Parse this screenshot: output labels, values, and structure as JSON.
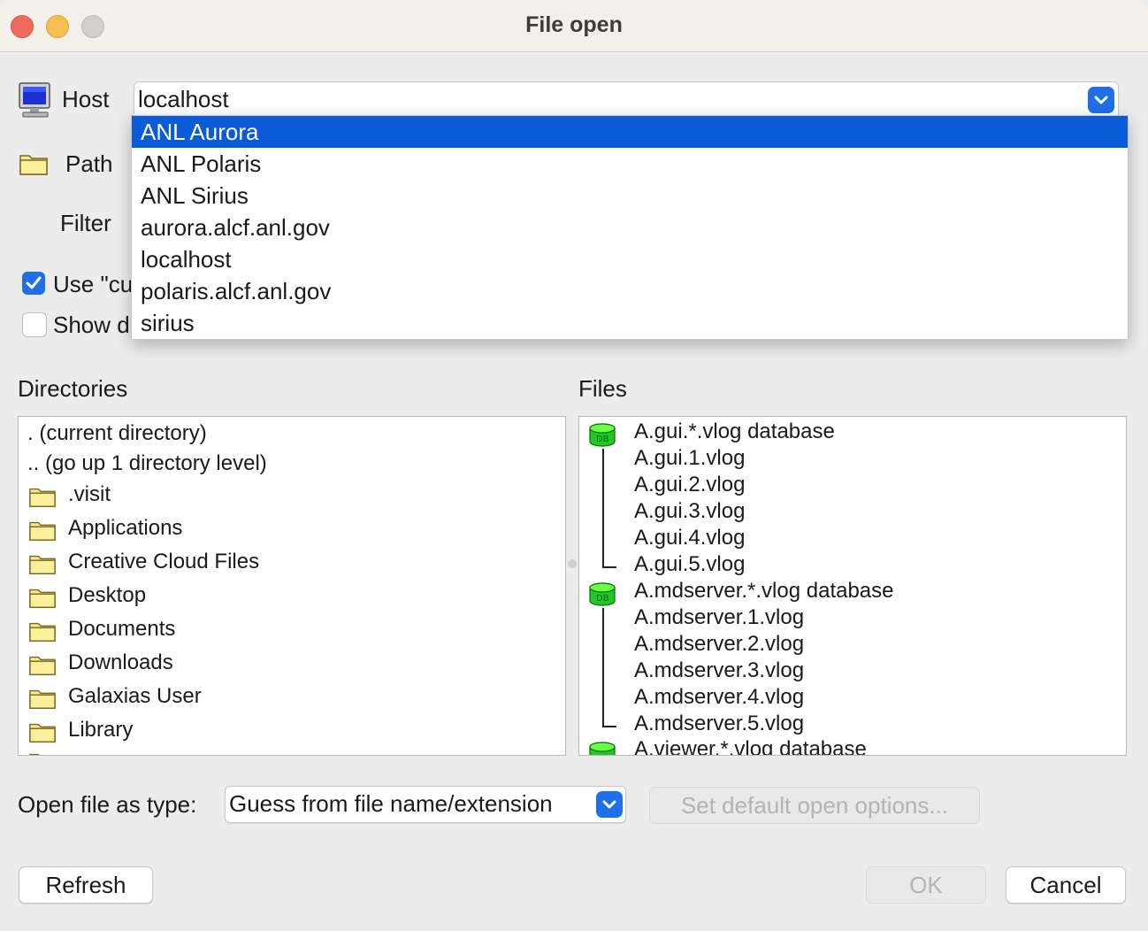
{
  "window": {
    "title": "File open"
  },
  "host": {
    "label": "Host",
    "value": "localhost"
  },
  "path": {
    "label": "Path"
  },
  "filter": {
    "label": "Filter"
  },
  "options": {
    "use_current_label": "Use \"cu",
    "use_current_checked": true,
    "show_label": "Show d",
    "show_checked": false
  },
  "host_dropdown": {
    "items": [
      "ANL Aurora",
      "ANL Polaris",
      "ANL Sirius",
      "aurora.alcf.anl.gov",
      "localhost",
      "polaris.alcf.anl.gov",
      "sirius"
    ],
    "selected_index": 0
  },
  "directories": {
    "label": "Directories",
    "special": [
      ". (current directory)",
      ".. (go up 1 directory level)"
    ],
    "folders": [
      ".visit",
      "Applications",
      "Creative Cloud Files",
      "Desktop",
      "Documents",
      "Downloads",
      "Galaxias User",
      "Library"
    ]
  },
  "files": {
    "label": "Files",
    "groups": [
      {
        "db": "A.gui.*.vlog database",
        "files": [
          "A.gui.1.vlog",
          "A.gui.2.vlog",
          "A.gui.3.vlog",
          "A.gui.4.vlog",
          "A.gui.5.vlog"
        ]
      },
      {
        "db": "A.mdserver.*.vlog database",
        "files": [
          "A.mdserver.1.vlog",
          "A.mdserver.2.vlog",
          "A.mdserver.3.vlog",
          "A.mdserver.4.vlog",
          "A.mdserver.5.vlog"
        ]
      },
      {
        "db": "A.viewer.*.vlog database",
        "files": []
      }
    ],
    "db_icon_text": "DB"
  },
  "open_as": {
    "label": "Open file as type:",
    "value": "Guess from file name/extension"
  },
  "buttons": {
    "set_default": "Set default open options...",
    "refresh": "Refresh",
    "ok": "OK",
    "cancel": "Cancel"
  },
  "colors": {
    "accent": "#1e6fe8",
    "selection": "#0b5bd7",
    "db_green": "#22c722"
  },
  "icons": {
    "host": "monitor-icon",
    "path": "folder-icon",
    "database": "database-icon",
    "dropdown": "chevron-down-icon"
  }
}
